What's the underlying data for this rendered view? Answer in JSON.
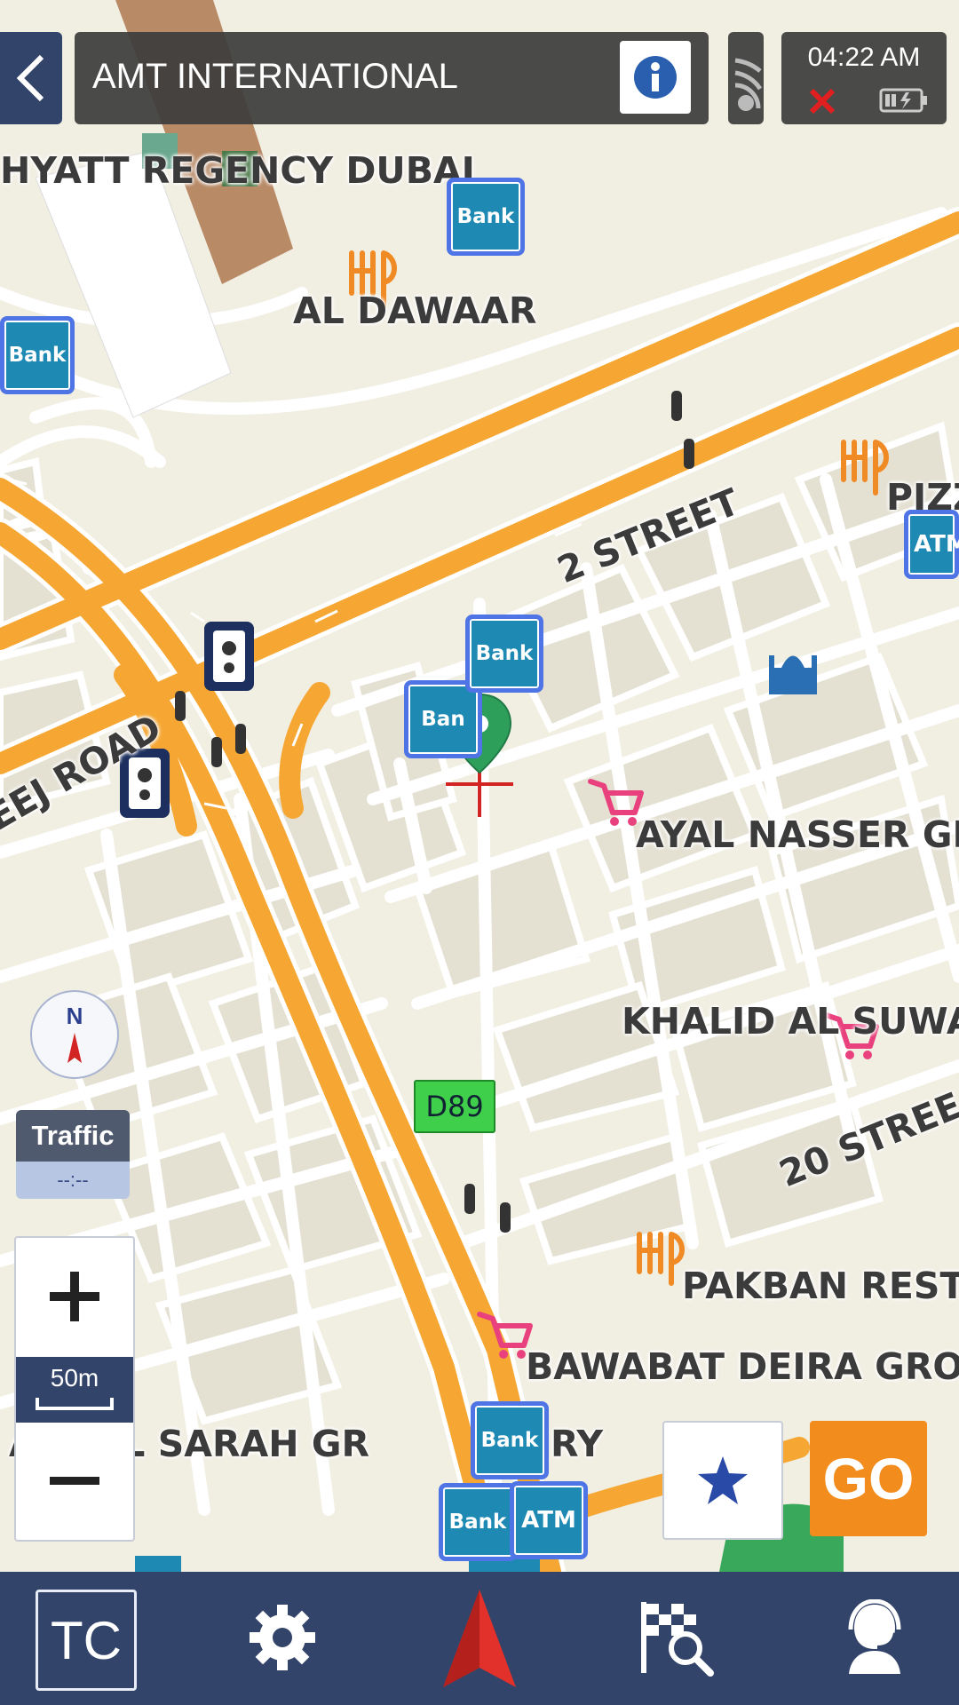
{
  "topbar": {
    "title": "AMT INTERNATIONAL",
    "time": "04:22 AM"
  },
  "map_labels": {
    "hyatt": "HYATT REGENCY DUBAI",
    "dawaar": "AL DAWAAR",
    "street2": "2 STREET",
    "road": "EEJ ROAD",
    "ayal": "AYAL NASSER GR",
    "khalid": "KHALID AL SUWA",
    "street20": "20 STREE",
    "pakban": "PAKBAN REST",
    "bawabat": "BAWABAT DEIRA GROC",
    "sarah": "AIN AL SARAH GR",
    "sarah2": "RY",
    "pizz": "PIZZ",
    "route": "D89"
  },
  "pois": {
    "bank": "Bank",
    "ban": "Ban",
    "atm": "ATM",
    "atm_clip": "ATM"
  },
  "controls": {
    "compass": "N",
    "traffic": "Traffic",
    "traffic_value": "--:--",
    "zoom_in": "+",
    "scale": "50m",
    "zoom_out": "−",
    "go": "GO"
  },
  "bottom_bar": {
    "tc": "TC"
  },
  "colors": {
    "map_bg": "#f1eee2",
    "road": "#f6a733",
    "bank_poi": "#1e89b3",
    "bottom_bar": "#33446b",
    "go_button": "#f28c1d"
  }
}
